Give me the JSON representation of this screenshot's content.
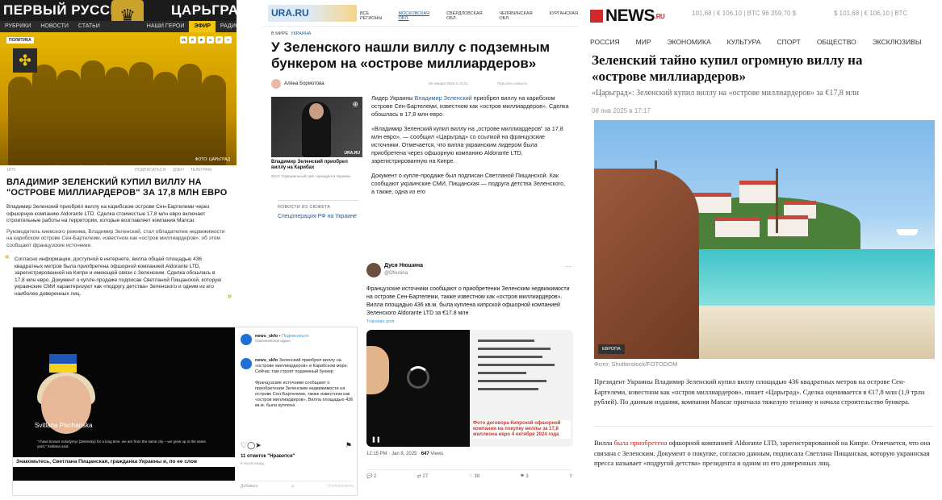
{
  "tsargrad": {
    "brand_left": "ПЕРВЫЙ РУССКИЙ",
    "brand_right": "ЦАРЬГРАД",
    "nav": [
      "РУБРИКИ",
      "НОВОСТИ",
      "СТАТЬИ",
      "НАШИ ГЕРОИ",
      "ЭФИР",
      "РАДИО"
    ],
    "tag": "ПОЛИТИКА",
    "photo_credit": "ФОТО: ЦАРЬГРАД",
    "meta_left": "1870",
    "meta_sub": "ПОДПИСАТЬСЯ:",
    "meta_dzen": "ДЗЕН",
    "meta_tg": "ТЕЛЕГРАМ",
    "title": "ВЛАДИМИР ЗЕЛЕНСКИЙ КУПИЛ ВИЛЛУ НА \"ОСТРОВЕ МИЛЛИАРДЕРОВ\" ЗА 17,8 МЛН ЕВРО",
    "lead": "Владимир Зеленский приобрёл виллу на карибском острове Сен-Бартелеми через офшорную компанию Aldorante LTD. Сделка стоимостью 17,8 млн евро включает строительные работы на территории, которые возглавляет компания Mancar.",
    "para": "Руководитель киевского режима, Владимир Зеленский, стал обладателем недвижимости на карибском острове Сен-Бартелеми, известном как «остров миллиардеров», об этом сообщают французские источники.",
    "quote": "Согласно информации, доступной в интернете, вилла общей площадью 436 квадратных метров была приобретена офшорной компанией Aldorante LTD, зарегистрированной на Кипре и имеющей связи с Зеленским. Сделка обошлась в 17,8 млн евро. Документ о купле-продаже подписан Светланой Пищанской, которую украинские СМИ характеризуют как «подругу детства» Зеленского и одним из его наиболее доверенных лиц."
  },
  "ura": {
    "logo": "URA.RU",
    "regions": [
      "ВСЕ РЕГИОНЫ",
      "МОСКОВСКАЯ ОБЛ.",
      "СВЕРДЛОВСКАЯ ОБЛ.",
      "ЧЕЛЯБИНСКАЯ ОБЛ.",
      "КУРГАНСКАЯ"
    ],
    "breadcrumb": "В МИРЕ",
    "breadcrumb_region": "УКРАИНА",
    "title": "У Зеленского нашли виллу с подземным бункером на «острове миллиардеров»",
    "author": "Алёна Бормотова",
    "date": "08 января 2025 в 18:31",
    "send": "Прислать новость",
    "image_wm": "URA.RU",
    "caption": "Владимир Зеленский приобрел виллу на Карибах",
    "caption_src": "Фото: Официальный сайт президента Украины",
    "news_heading": "НОВОСТИ ИЗ СЮЖЕТА",
    "news_link": "Спецоперация РФ на Украине",
    "p1_pre": "Лидер Украины ",
    "p1_link": "Владимир Зеленский",
    "p1_post": " приобрел виллу на карибском острове Сен-Бартелеми, известном как «остров миллиардеров». Сделка обошлась в 17,8 млн евро.",
    "p2": "«Владимир Зеленский купил виллу на „острове миллиардеров“ за 17,8 млн евро», — сообщил «Царьград» со ссылкой на французские источники. Отмечается, что вилла украинским лидером была приобретена через офшорную компанию Aldorante LTD, зарегистрированную на Кипре.",
    "p3": "Документ о купле-продаже был подписан Светланой Пищанской. Как сообщают украинские СМИ, Пищанская — подруга детства Зеленского, а также, одна из его"
  },
  "tweet": {
    "name": "Дуся Нюшина",
    "handle": "@DNusina",
    "text": "Французские источники сообщают о приобретении Зеленским недвижимости на острове Сен-Бартелеми, также известном как «остров миллиардеров». Вилла площадью 436 кв.м. была куплена кипрской офшорной компанией Зеленского Aldorante LTD за €17.8 млн",
    "translate": "Translate post",
    "doc_caption": "Фото договора Кипрской офшорной компании на покупку виллы за 17,8 миллиона евро 4 октября 2024 года",
    "time": "12:15 PM · Jan 8, 2025 · ",
    "views": "647",
    "views_label": " Views",
    "replies": "2",
    "retweets": "27",
    "likes": "38",
    "bookmarks": "3"
  },
  "instagram": {
    "person_name": "Svitlana Pischanska",
    "subtitle": "\"I have known Volodymyr (Zelensky) for a long time, we are from the same city – we grew up in the same yard,\" Svitlana said.",
    "caption_bar": "Знакомьтесь, Светлана Пищанская, гражданка Украины и, по ее слов",
    "user": "news_skfo",
    "follow": "Подписаться",
    "audio": "Оригинальное аудио",
    "post_user": "news_skfo",
    "post_text": "Зеленский приобрел виллу на «острове миллиардеров» в Карибском море. Сейчас там строят подземный бункер",
    "post_text2": "Французские источники сообщают о приобретении Зеленским недвижимости на острове Сен-Бартелеми, также известном как «остров миллиардеров». Вилла площадью 436 кв.м. была куплена",
    "likes": "11 отметок \"Нравится\"",
    "ago": "8 часов назад",
    "comment_placeholder": "Добавьте",
    "publish": "Опубликовать"
  },
  "newsru": {
    "logo": "NEWS",
    "logo_sup": ".RU",
    "rates1": "101,68  |  € 106,10  |  BTC 96 359,70 $",
    "rates2": "$ 101,68  |  € 106,10  |  BTC",
    "nav": [
      "РОССИЯ",
      "МИР",
      "ЭКОНОМИКА",
      "КУЛЬТУРА",
      "СПОРТ",
      "ОБЩЕСТВО",
      "ЭКСКЛЮЗИВЫ"
    ],
    "title": "Зеленский тайно купил огромную виллу на «острове миллиардеров»",
    "lead": "«Царьград»: Зеленский купил виллу на «острове миллиардеров» за €17,8 млн",
    "date": "08 янв 2025 в 17:17",
    "badge": "ЕВРОПА",
    "photo_credit": "Фото: Shutterstock/FOTODOM",
    "p1": "Президент Украины Владимир Зеленский купил виллу площадью 436 квадратных метров на острове Сен-Бартелеми, известном как «остров миллиардеров», пишет «Царьград». Сделка оценивается в €17,8 млн (1,9 трлн рублей). По данным издания, компания Mancar пригнала тяжелую технику и начала строительство бункера.",
    "p2_pre": "Вилла ",
    "p2_link": "была приобретена",
    "p2_post": " офшорной компанией Aldorante LTD, зарегистрированной на Кипре. Отмечается, что она связана с Зеленским. Документ о покупке, согласно данным, подписала Светлана Пищанская, которую украинская пресса называет «подругой детства» президента и одним из его доверенных лиц."
  }
}
